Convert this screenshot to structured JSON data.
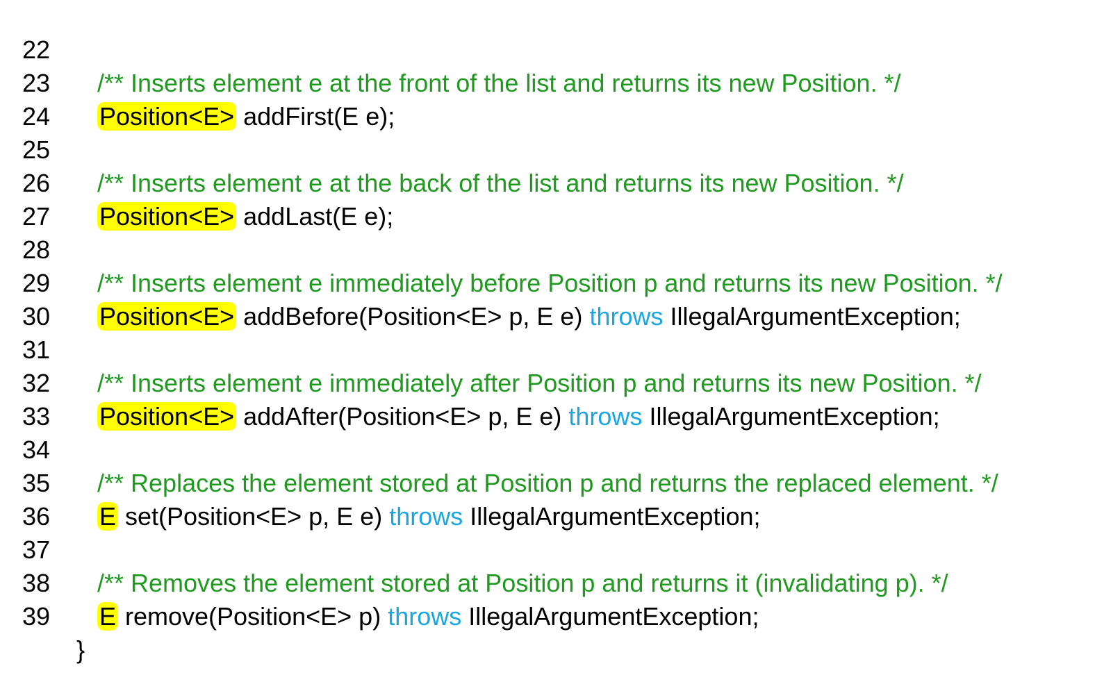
{
  "lines": [
    {
      "num": "22",
      "comment": "/** Inserts element e at the front of the list and returns its new Position. */"
    },
    {
      "num": "23",
      "ret": "Position<E>",
      "code": " addFirst(E e);"
    },
    {
      "num": "24"
    },
    {
      "num": "25",
      "comment": "/** Inserts element e at the back of the list and returns its new Position. */"
    },
    {
      "num": "26",
      "ret": "Position<E>",
      "code": " addLast(E e);"
    },
    {
      "num": "27"
    },
    {
      "num": "28",
      "comment": "/** Inserts element e immediately before Position p and returns its new Position. */"
    },
    {
      "num": "29",
      "ret": "Position<E>",
      "code": " addBefore(Position<E> p, E e) ",
      "kw": "throws",
      "after": " IllegalArgumentException;"
    },
    {
      "num": "30"
    },
    {
      "num": "31",
      "comment": "/** Inserts element e immediately after Position p and returns its new Position. */"
    },
    {
      "num": "32",
      "ret": "Position<E>",
      "code": " addAfter(Position<E> p, E e) ",
      "kw": "throws",
      "after": " IllegalArgumentException;"
    },
    {
      "num": "33"
    },
    {
      "num": "34",
      "comment": "/** Replaces the element stored at Position p and returns the replaced element. */"
    },
    {
      "num": "35",
      "ret": "E",
      "code": " set(Position<E> p, E e) ",
      "kw": "throws",
      "after": " IllegalArgumentException;"
    },
    {
      "num": "36"
    },
    {
      "num": "37",
      "comment": "/** Removes the element stored at Position p and returns it (invalidating p). */"
    },
    {
      "num": "38",
      "ret": "E",
      "code": " remove(Position<E> p) ",
      "kw": "throws",
      "after": " IllegalArgumentException;"
    },
    {
      "num": "39",
      "code": "}"
    }
  ],
  "colors": {
    "comment": "#1f9a1f",
    "keyword": "#1aa6e0",
    "highlight": "#ffff00",
    "text": "#000000"
  }
}
